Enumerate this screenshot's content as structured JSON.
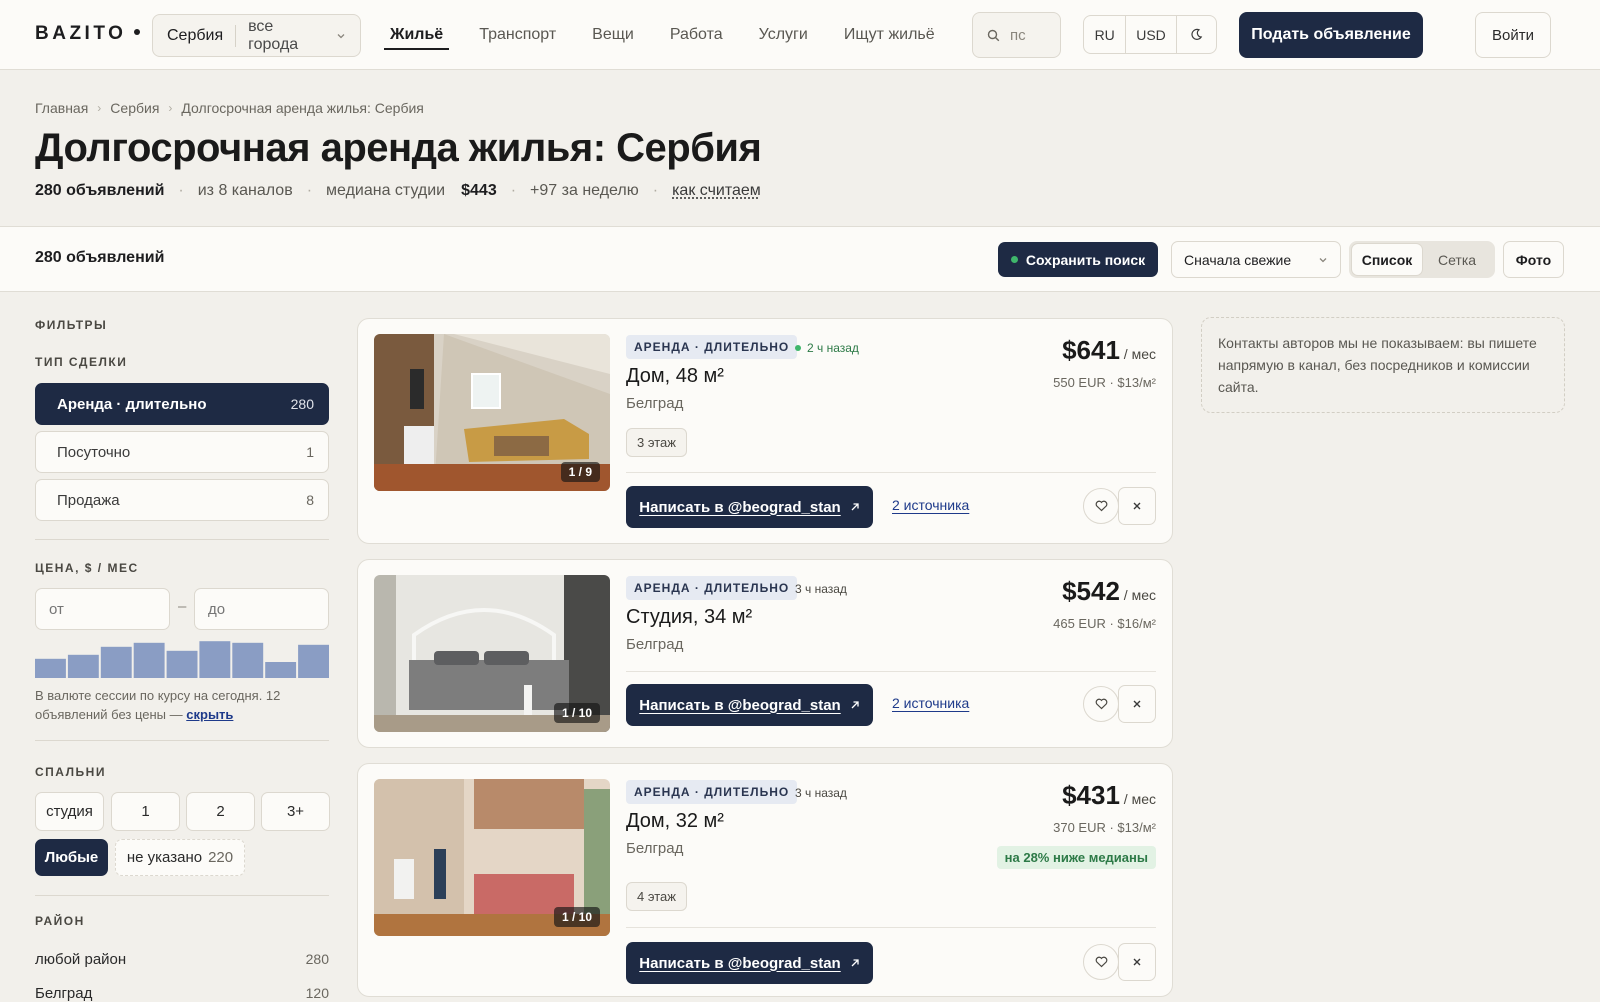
{
  "nav": {
    "logo": "BAZITO",
    "country": "Сербия",
    "city": "все города",
    "links": [
      "Жильё",
      "Транспорт",
      "Вещи",
      "Работа",
      "Услуги",
      "Ищут жильё"
    ],
    "search_value": "пс",
    "lang": "RU",
    "currency": "USD",
    "theme_icon": "moon-icon",
    "post_label": "Подать объявление",
    "login_label": "Войти"
  },
  "breadcrumb": [
    "Главная",
    "Сербия",
    "Долгосрочная аренда жилья: Сербия"
  ],
  "header": {
    "title": "Долгосрочная аренда жилья: Сербия",
    "count": "280 объявлений",
    "channels": "из 8 каналов",
    "median_label": "медиана студии",
    "median_value": "$443",
    "weekly": "+97 за неделю",
    "how_link": "как считаем"
  },
  "toolbar": {
    "count": "280 объявлений",
    "save_label": "Сохранить поиск",
    "sort_label": "Сначала свежие",
    "view_list": "Список",
    "view_grid": "Сетка",
    "photo_label": "Фото"
  },
  "filters": {
    "heading": "ФИЛЬТРЫ",
    "deal_heading": "ТИП СДЕЛКИ",
    "deal_items": [
      {
        "label": "Аренда · длительно",
        "count": "280"
      },
      {
        "label": "Посуточно",
        "count": "1"
      },
      {
        "label": "Продажа",
        "count": "8"
      }
    ],
    "price_heading": "ЦЕНА, $ / МЕС",
    "price_from": "от",
    "price_to": "до",
    "histogram": [
      0.48,
      0.58,
      0.78,
      0.88,
      0.68,
      0.92,
      0.88,
      0.4,
      0.83
    ],
    "price_note": "В валюте сессии по курсу на сегодня. 12 объявлений без цены —",
    "price_note_link": "скрыть",
    "bed_heading": "СПАЛЬНИ",
    "beds": [
      "студия",
      "1",
      "2",
      "3+"
    ],
    "bed_any": "Любые",
    "bed_unknown": "не указано",
    "bed_unknown_count": "220",
    "district_heading": "РАЙОН",
    "districts": [
      {
        "label": "любой район",
        "count": "280"
      },
      {
        "label": "Белград",
        "count": "120"
      }
    ]
  },
  "listings": [
    {
      "badge": "АРЕНДА · ДЛИТЕЛЬНО",
      "time": "2 ч назад",
      "title": "Дом, 48 м²",
      "city": "Белград",
      "floor": "3 этаж",
      "price": "$641",
      "price_unit": "/ мес",
      "price_sub": "550 EUR · $13/м²",
      "photo_count": "1 / 9",
      "write_label": "Написать в @beograd_stan",
      "sources": "2 источника"
    },
    {
      "badge": "АРЕНДА · ДЛИТЕЛЬНО",
      "time": "3 ч назад",
      "title": "Студия, 34 м²",
      "city": "Белград",
      "price": "$542",
      "price_unit": "/ мес",
      "price_sub": "465 EUR · $16/м²",
      "photo_count": "1 / 10",
      "write_label": "Написать в @beograd_stan",
      "sources": "2 источника"
    },
    {
      "badge": "АРЕНДА · ДЛИТЕЛЬНО",
      "time": "3 ч назад",
      "title": "Дом, 32 м²",
      "city": "Белград",
      "floor": "4 этаж",
      "price": "$431",
      "price_unit": "/ мес",
      "price_sub": "370 EUR · $13/м²",
      "below_median": "на 28% ниже медианы",
      "photo_count": "1 / 10",
      "write_label": "Написать в @beograd_stan"
    }
  ],
  "info_note": "Контакты авторов мы не показываем: вы пишете напрямую в канал, без посредников и комиссии сайта.",
  "colors": {
    "accent": "#1e2a44",
    "fresh": "#3fb66b",
    "histogram": "#8a9dc4",
    "link": "#1e3a8a"
  }
}
